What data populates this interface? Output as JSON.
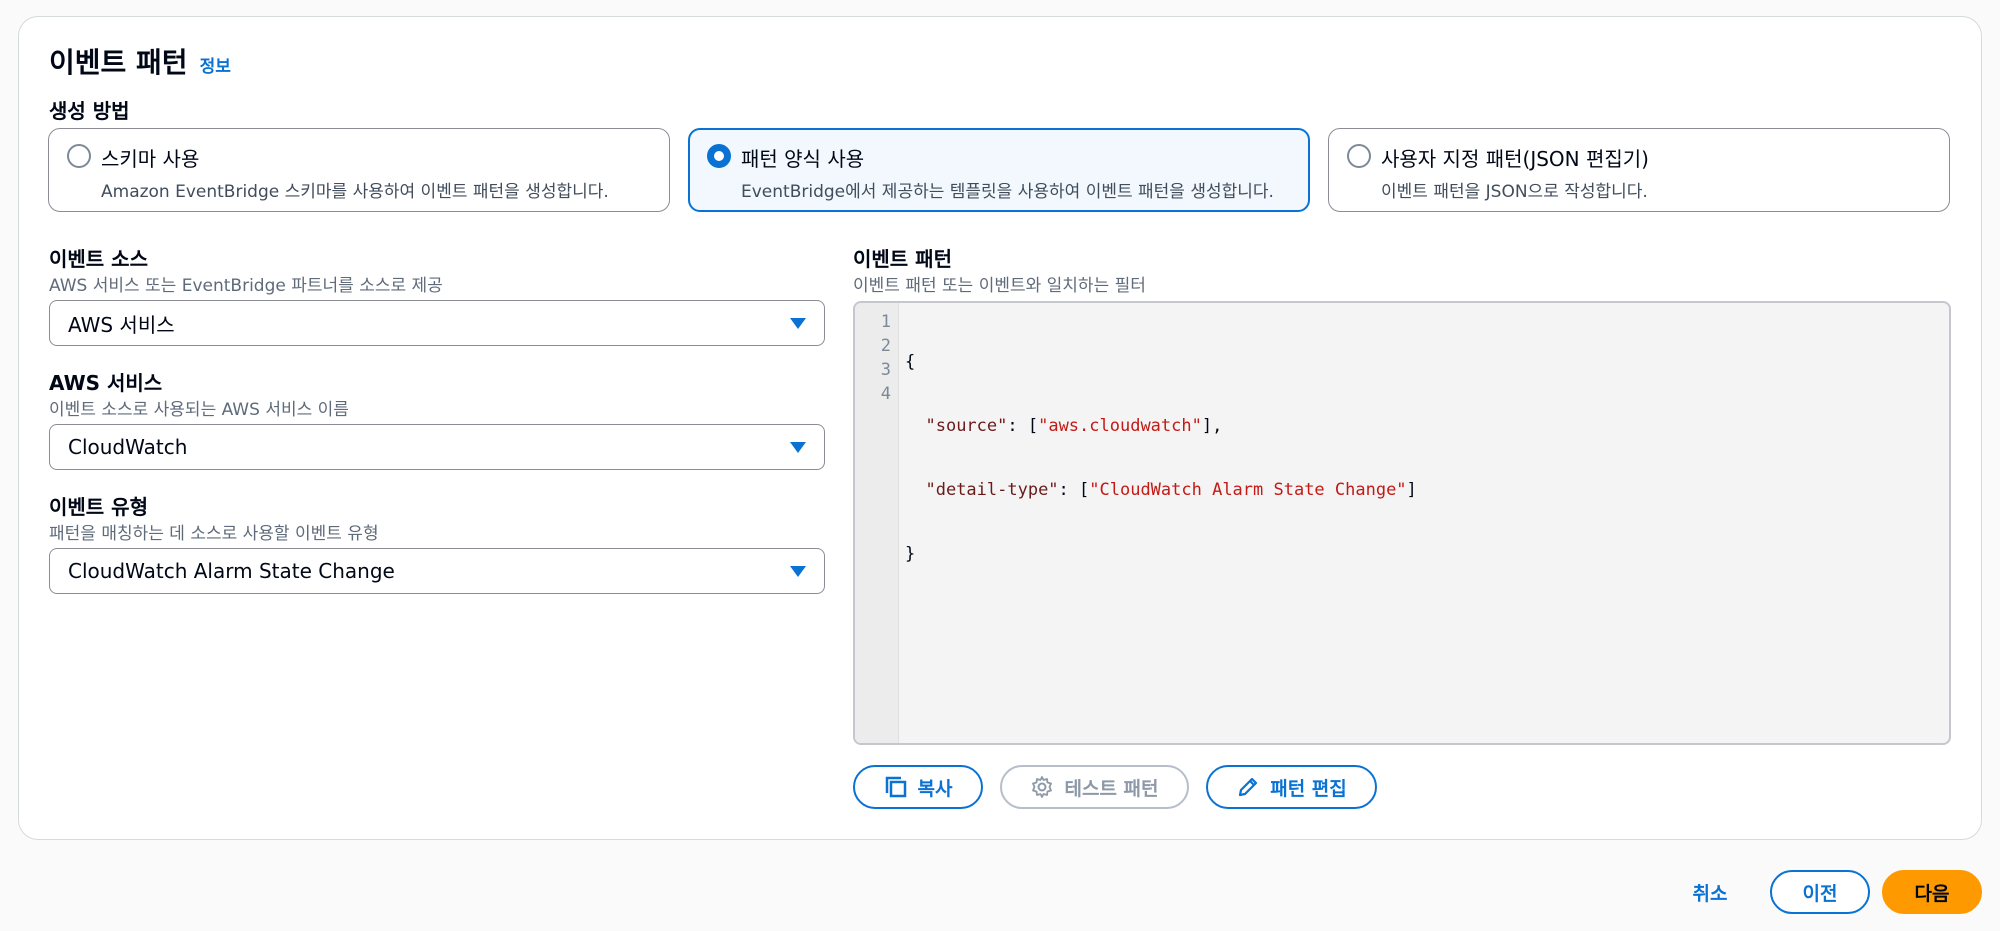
{
  "panel": {
    "title": "이벤트 패턴",
    "info_link": "정보"
  },
  "creation_method": {
    "label": "생성 방법",
    "options": [
      {
        "title": "스키마 사용",
        "desc": "Amazon EventBridge 스키마를 사용하여 이벤트 패턴을 생성합니다.",
        "selected": false
      },
      {
        "title": "패턴 양식 사용",
        "desc": "EventBridge에서 제공하는 템플릿을 사용하여 이벤트 패턴을 생성합니다.",
        "selected": true
      },
      {
        "title": "사용자 지정 패턴(JSON 편집기)",
        "desc": "이벤트 패턴을 JSON으로 작성합니다.",
        "selected": false
      }
    ]
  },
  "event_source": {
    "label": "이벤트 소스",
    "desc": "AWS 서비스 또는 EventBridge 파트너를 소스로 제공",
    "value": "AWS 서비스"
  },
  "aws_service": {
    "label": "AWS 서비스",
    "desc": "이벤트 소스로 사용되는 AWS 서비스 이름",
    "value": "CloudWatch"
  },
  "event_type": {
    "label": "이벤트 유형",
    "desc": "패턴을 매칭하는 데 소스로 사용할 이벤트 유형",
    "value": "CloudWatch Alarm State Change"
  },
  "event_pattern": {
    "label": "이벤트 패턴",
    "desc": "이벤트 패턴 또는 이벤트와 일치하는 필터",
    "line_numbers": [
      "1",
      "2",
      "3",
      "4"
    ],
    "code": {
      "open": "{",
      "source_key": "\"source\"",
      "source_val": "\"aws.cloudwatch\"",
      "detail_key": "\"detail-type\"",
      "detail_val": "\"CloudWatch Alarm State Change\"",
      "close": "}"
    }
  },
  "pattern_actions": {
    "copy": "복사",
    "test": "테스트 패턴",
    "edit": "패턴 편집"
  },
  "footer": {
    "cancel": "취소",
    "previous": "이전",
    "next": "다음"
  },
  "colors": {
    "accent": "#0972d3",
    "primary_button": "#ff9900"
  }
}
